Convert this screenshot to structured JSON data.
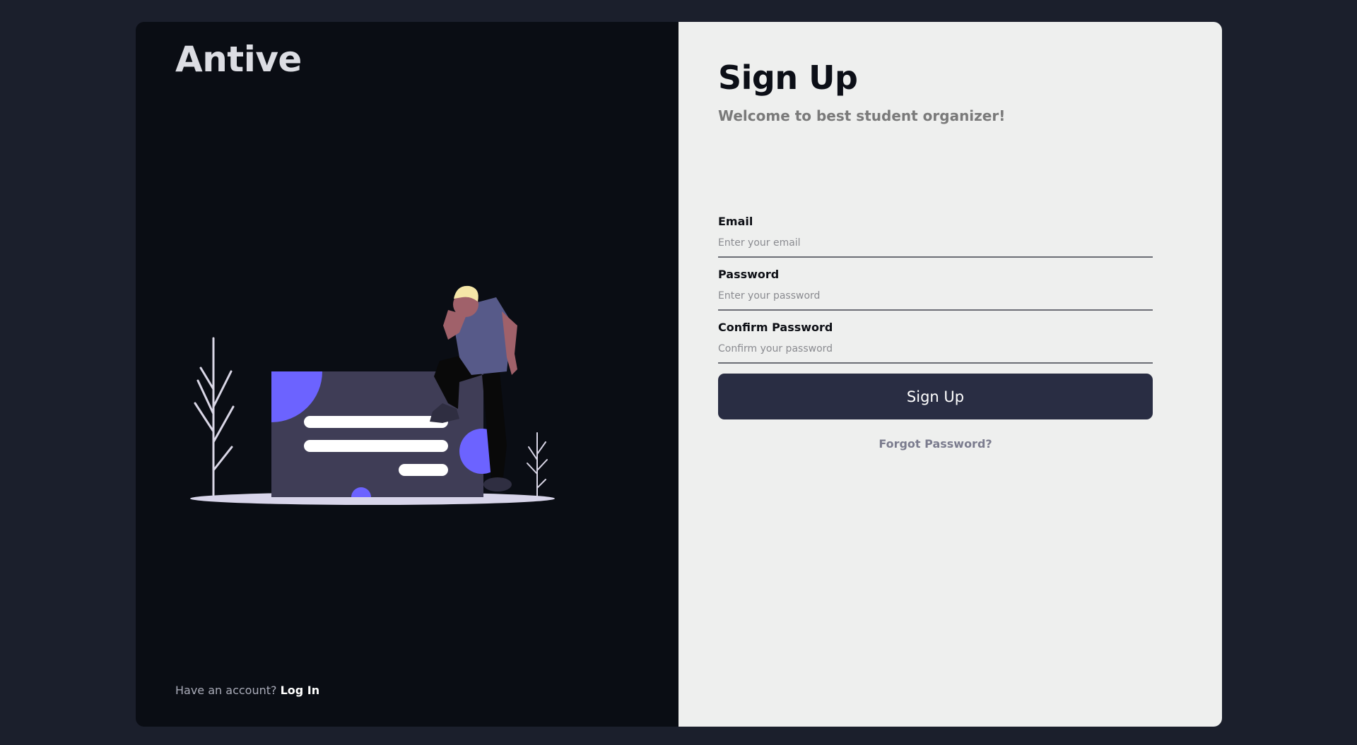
{
  "brand": {
    "name": "Antive"
  },
  "left_panel": {
    "illustration_icon": "person-thinking-illustration",
    "footer": {
      "prompt": "Have an account?",
      "link_label": "Log In"
    }
  },
  "signup": {
    "title": "Sign Up",
    "subtitle": "Welcome to best student organizer!",
    "fields": [
      {
        "label": "Email",
        "placeholder": "Enter your email",
        "value": ""
      },
      {
        "label": "Password",
        "placeholder": "Enter your password",
        "value": ""
      },
      {
        "label": "Confirm Password",
        "placeholder": "Confirm your password",
        "value": ""
      }
    ],
    "submit_label": "Sign Up",
    "forgot_label": "Forgot Password?"
  },
  "colors": {
    "page_bg": "#1b1f2c",
    "left_bg": "#0a0d14",
    "right_bg": "#eeefee",
    "button_bg": "#292d43",
    "accent_purple": "#6c63ff"
  }
}
